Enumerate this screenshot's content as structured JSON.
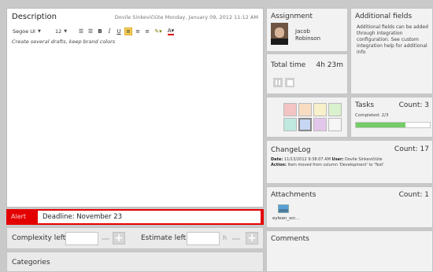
{
  "description": {
    "title": "Description",
    "meta": "Dovile Sinkevičiūte Monday, January 09, 2012 11:12 AM",
    "font_family": "Segoe UI",
    "font_size": "12",
    "body": "Create several drafts, keep brand colors"
  },
  "toolbar": {
    "bold": "B",
    "italic": "I",
    "underline": "U"
  },
  "alert": {
    "label": "Alert",
    "value": "Deadline: November 23"
  },
  "estimates": {
    "complexity_label": "Complexity left:",
    "estimate_label": "Estimate left:",
    "unit": "h"
  },
  "categories": {
    "title": "Categories"
  },
  "assignment": {
    "title": "Assignment",
    "first_name": "Jacob",
    "last_name": "Robinson"
  },
  "additional_fields": {
    "title": "Additional fields",
    "text": "Additional fields can be added through integration configuration. See custom integration help for additional info"
  },
  "total_time": {
    "title": "Total time",
    "value": "4h 23m"
  },
  "tasks": {
    "title": "Tasks",
    "count": "Count: 3",
    "completed": "Completed: 2/3",
    "progress": 0.667
  },
  "changelog": {
    "title": "ChangeLog",
    "count": "Count: 17",
    "date_label": "Date:",
    "date": "11/13/2012 9:38:07 AM",
    "user_label": "User:",
    "user": "Dovile Sinkevičiūte",
    "action_label": "Action:",
    "action": "Item moved from column 'Development' to 'Test'"
  },
  "attachments": {
    "title": "Attachments",
    "count": "Count: 1",
    "file_name": "eylean_scr..."
  },
  "comments": {
    "title": "Comments"
  },
  "colors": {
    "alert": "#e30000",
    "progress": "#74cc66",
    "highlight": "#f6cf55"
  },
  "swatches": [
    "#f4c4c4",
    "#f7dcc2",
    "#f7f0c9",
    "#d9f1cc",
    "#bfe9df",
    "#c6d6f3",
    "#e3c6ec",
    "#f6f6f6"
  ]
}
